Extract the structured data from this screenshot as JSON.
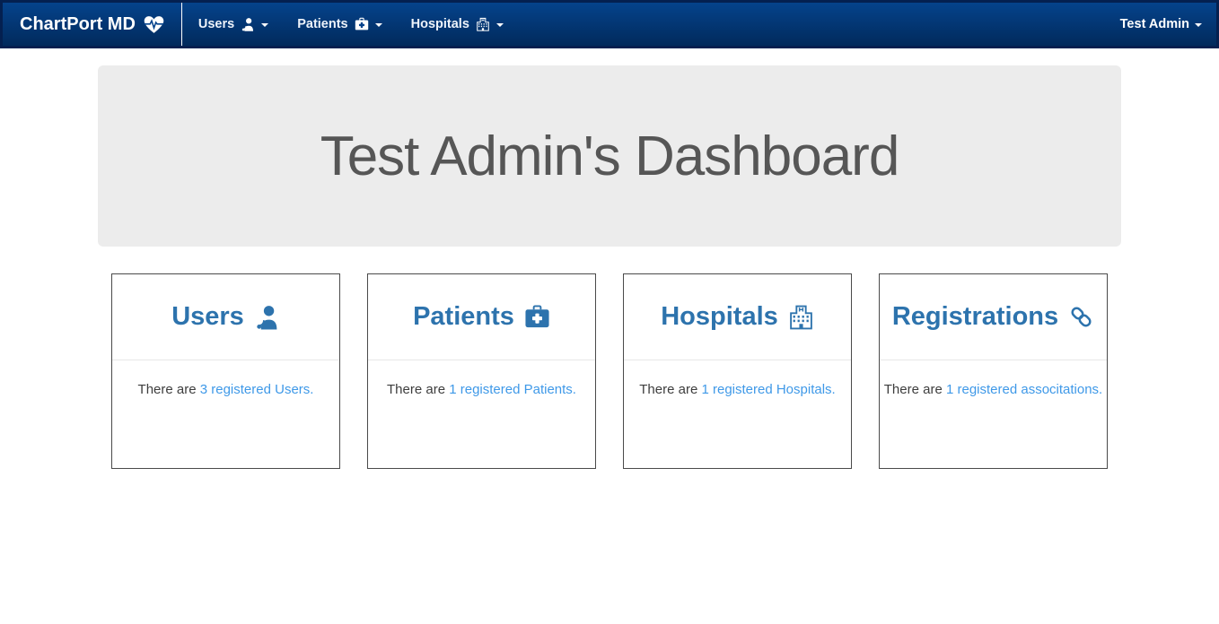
{
  "navbar": {
    "brand": {
      "label": "ChartPort MD",
      "icon": "heartbeat-icon"
    },
    "items": [
      {
        "label": "Users",
        "icon": "user-md-icon",
        "dropdown_caret": "caret-down-icon"
      },
      {
        "label": "Patients",
        "icon": "medkit-icon",
        "dropdown_caret": "caret-down-icon"
      },
      {
        "label": "Hospitals",
        "icon": "hospital-icon",
        "dropdown_caret": "caret-down-icon"
      }
    ],
    "user_menu": {
      "label": "Test Admin",
      "dropdown_caret": "caret-down-icon"
    }
  },
  "jumbotron": {
    "title": "Test Admin's Dashboard"
  },
  "panels": [
    {
      "title": "Users",
      "icon": "user-md-icon",
      "text_prefix": "There are ",
      "count": 3,
      "link_text": "3 registered Users."
    },
    {
      "title": "Patients",
      "icon": "medkit-icon",
      "text_prefix": "There are ",
      "count": 1,
      "link_text": "1 registered Patients."
    },
    {
      "title": "Hospitals",
      "icon": "hospital-icon",
      "text_prefix": "There are ",
      "count": 1,
      "link_text": "1 registered Hospitals."
    },
    {
      "title": "Registrations",
      "icon": "link-icon",
      "text_prefix": "There are ",
      "count": 1,
      "link_text": "1 registered associtations."
    }
  ],
  "colors": {
    "navbar_gradient_top": "#05438c",
    "navbar_gradient_bottom": "#012a5c",
    "navbar_border": "#042050",
    "panel_title_blue": "#2d73ad",
    "link_blue": "#3f99e8",
    "panel_border": "#4a4a4a",
    "jumbotron_bg": "#ececec",
    "jumbotron_title_gray": "#565656"
  }
}
